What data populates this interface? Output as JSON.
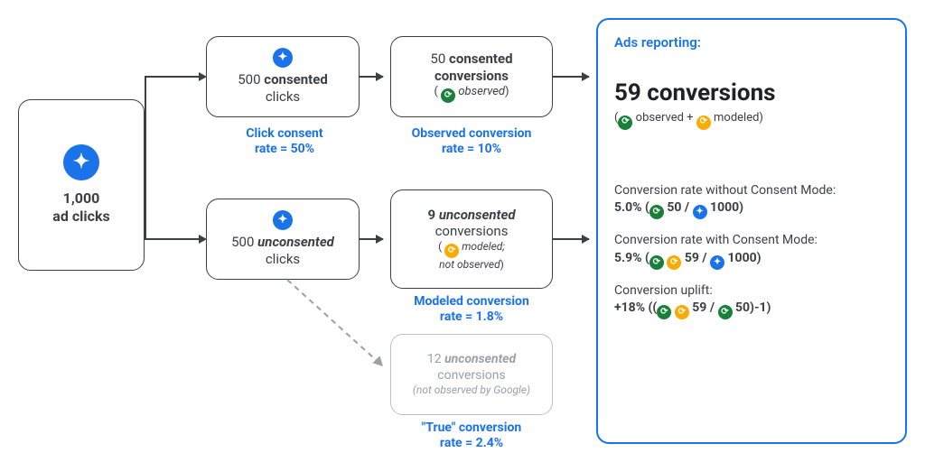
{
  "start": {
    "value": "1,000",
    "label": "ad clicks"
  },
  "consented": {
    "count": "500",
    "word": "consented",
    "label": "clicks"
  },
  "unconsented": {
    "count": "500",
    "word": "unconsented",
    "label": "clicks"
  },
  "consented_conv": {
    "count": "50",
    "word": "consented",
    "label": "conversions",
    "note": "observed"
  },
  "unconsented_conv": {
    "count": "9",
    "word": "unconsented",
    "label": "conversions",
    "note1": "modeled;",
    "note2": "not observed"
  },
  "ghost": {
    "count": "12",
    "word": "unconsented",
    "label": "conversions",
    "note": "(not observed by Google)"
  },
  "rates": {
    "consent_rate": {
      "l1": "Click consent",
      "l2": "rate = 50%"
    },
    "observed": {
      "l1": "Observed conversion",
      "l2": "rate = 10%"
    },
    "modeled": {
      "l1": "Modeled conversion",
      "l2": "rate = 1.8%"
    },
    "true": {
      "l1": "\"True\" conversion",
      "l2": "rate = 2.4%"
    }
  },
  "report": {
    "title": "Ads reporting:",
    "headline": "59 conversions",
    "sub_pre": "(",
    "sub_mid": " observed + ",
    "sub_post": " modeled)",
    "m1_label": "Conversion rate without Consent Mode:",
    "m1_val": "5.0% (",
    "m1_a": " 50 / ",
    "m1_b": " 1000)",
    "m2_label": "Conversion rate with Consent Mode:",
    "m2_val": "5.9% (",
    "m2_a": " 59 / ",
    "m2_b": " 1000)",
    "m3_label": "Conversion uplift:",
    "m3_val": "+18% ((",
    "m3_a": " 59 / ",
    "m3_b": " 50)-1)"
  },
  "chart_data": {
    "type": "diagram",
    "total_ad_clicks": 1000,
    "click_consent_rate": 0.5,
    "consented_clicks": 500,
    "unconsented_clicks": 500,
    "observed_conversion_rate": 0.1,
    "consented_conversions_observed": 50,
    "modeled_conversion_rate": 0.018,
    "unconsented_conversions_modeled": 9,
    "true_unconsented_conversion_rate": 0.024,
    "true_unconsented_conversions": 12,
    "reported_conversions": 59,
    "conversion_rate_without_consent_mode": 0.05,
    "conversion_rate_with_consent_mode": 0.059,
    "conversion_uplift": 0.18
  }
}
